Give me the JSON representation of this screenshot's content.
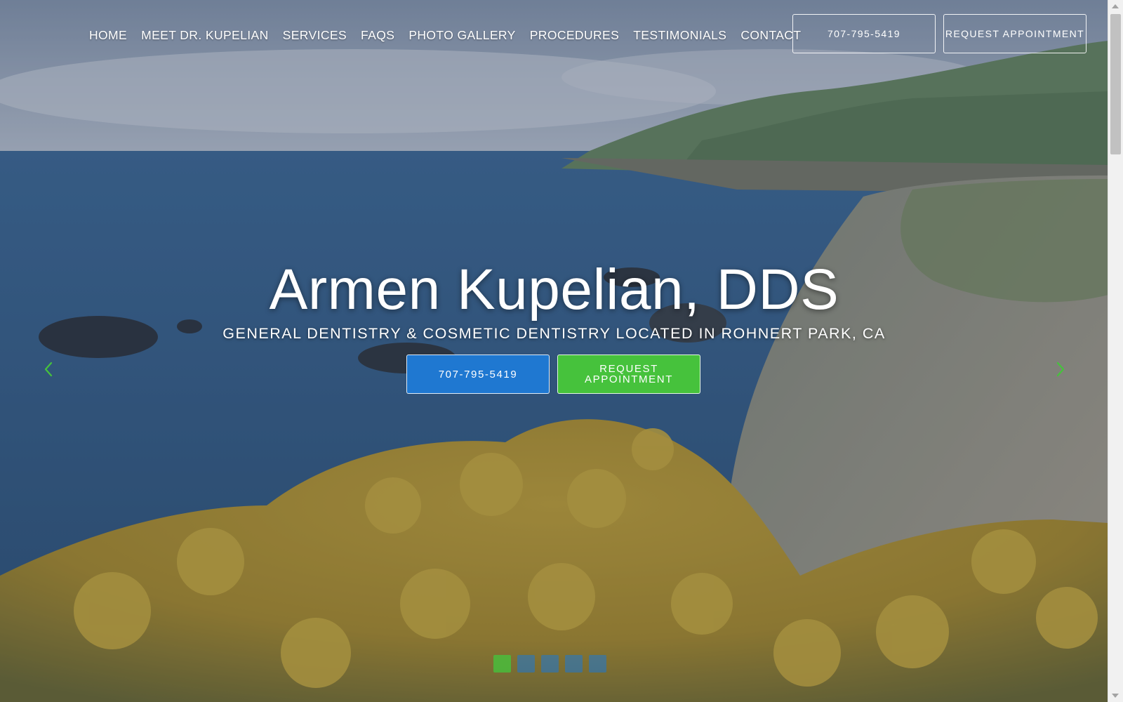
{
  "nav": {
    "items": [
      {
        "label": "HOME"
      },
      {
        "label": "MEET DR. KUPELIAN"
      },
      {
        "label": "SERVICES"
      },
      {
        "label": "FAQS"
      },
      {
        "label": "PHOTO GALLERY"
      },
      {
        "label": "PROCEDURES"
      },
      {
        "label": "TESTIMONIALS"
      },
      {
        "label": "CONTACT"
      }
    ],
    "phone_label": "707-795-5419",
    "request_label": "REQUEST APPOINTMENT"
  },
  "hero": {
    "title": "Armen Kupelian, DDS",
    "subtitle": "GENERAL DENTISTRY & COSMETIC DENTISTRY LOCATED IN ROHNERT PARK, CA",
    "phone_label": "707-795-5419",
    "request_label": "REQUEST APPOINTMENT"
  },
  "carousel": {
    "slide_count": 5,
    "active_index": 0
  },
  "colors": {
    "phone_button": "#1f78d1",
    "request_button": "#46c23c",
    "arrow": "#46c23c"
  },
  "icons": {
    "prev": "chevron-left-icon",
    "next": "chevron-right-icon"
  }
}
